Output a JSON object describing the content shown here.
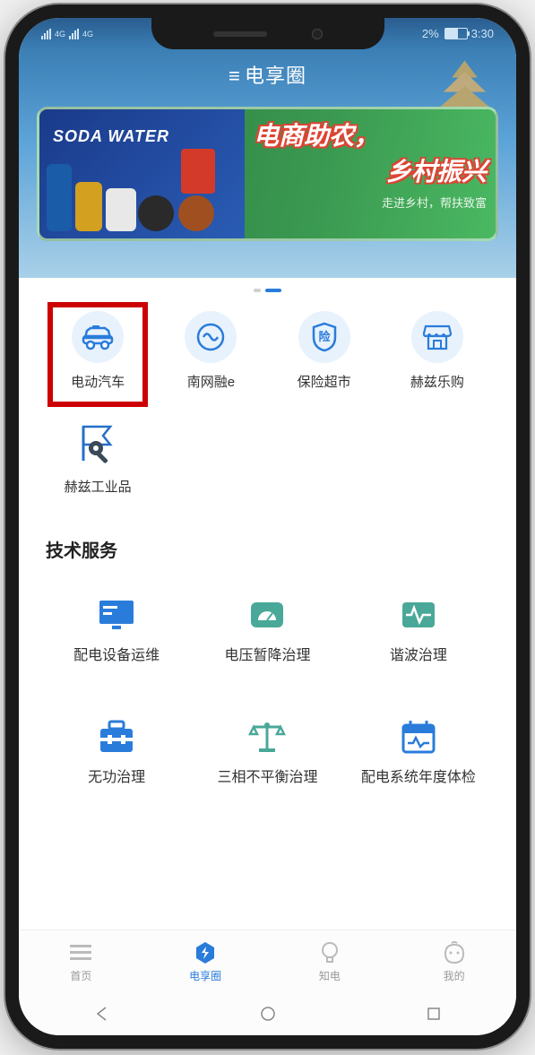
{
  "status": {
    "battery_pct": "2%",
    "time": "3:30"
  },
  "app_title": "电享圈",
  "banner": {
    "soda": "SODA WATER",
    "title_line1": "电商助农，",
    "title_line2": "乡村振兴",
    "subtitle": "走进乡村，帮扶致富"
  },
  "quick_icons": [
    {
      "label": "电动汽车",
      "icon": "car"
    },
    {
      "label": "南网融e",
      "icon": "swirl"
    },
    {
      "label": "保险超市",
      "icon": "shield-insurance",
      "badge": "险"
    },
    {
      "label": "赫兹乐购",
      "icon": "shop"
    },
    {
      "label": "赫兹工业品",
      "icon": "tool-flag"
    }
  ],
  "section_title": "技术服务",
  "services": [
    {
      "label": "配电设备运维",
      "icon": "monitor",
      "color": "#2a7cdb"
    },
    {
      "label": "电压暂降治理",
      "icon": "gauge",
      "color": "#4aa898"
    },
    {
      "label": "谐波治理",
      "icon": "wave",
      "color": "#4aa898"
    },
    {
      "label": "无功治理",
      "icon": "toolbox",
      "color": "#2a7cdb"
    },
    {
      "label": "三相不平衡治理",
      "icon": "scale",
      "color": "#4aa898"
    },
    {
      "label": "配电系统年度体检",
      "icon": "calendar",
      "color": "#2a7cdb"
    }
  ],
  "tabs": [
    {
      "label": "首页",
      "icon": "home-lines"
    },
    {
      "label": "电享圈",
      "icon": "bolt-hex",
      "active": true
    },
    {
      "label": "知电",
      "icon": "bulb"
    },
    {
      "label": "我的",
      "icon": "face"
    }
  ]
}
